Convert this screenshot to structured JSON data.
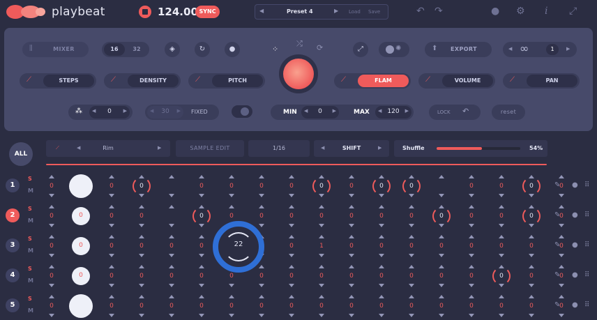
{
  "app": {
    "name": "playbeat",
    "bpm": "124.00",
    "sync_label": "SYNC"
  },
  "preset": {
    "name": "Preset 4",
    "load": "Load",
    "save": "Save"
  },
  "panel": {
    "mixer": "MIXER",
    "step16": "16",
    "step32": "32",
    "export": "EXPORT",
    "loop_count": "1",
    "steps": "STEPS",
    "density": "DENSITY",
    "pitch": "PITCH",
    "flam": "FLAM",
    "volume": "VOLUME",
    "pan": "PAN",
    "humanize_value": "0",
    "fixed_value": "30",
    "fixed_label": "FIXED",
    "min_label": "MIN",
    "min_value": "0",
    "max_label": "MAX",
    "max_value": "120",
    "lock": "LOCK",
    "reset": "reset"
  },
  "subbar": {
    "all": "ALL",
    "sound": "Rim",
    "sample_edit": "SAMPLE EDIT",
    "division": "1/16",
    "mode": "SHIFT",
    "shuffle_label": "Shuffle",
    "shuffle_value": "54%",
    "shuffle_level": 0.54
  },
  "colors": {
    "accent": "#ef5b5b",
    "focus": "#2f6fd6",
    "panel": "#474a6a",
    "bg": "#2b2d42"
  },
  "rows": [
    {
      "num": "1",
      "s": "S",
      "m": "M",
      "cells": [
        "0",
        "",
        "0",
        "0",
        "",
        "0",
        "0",
        "0",
        "0",
        "0",
        "0",
        "0",
        "0",
        "",
        "0",
        "0",
        "0",
        "0"
      ]
    },
    {
      "num": "2",
      "s": "S",
      "m": "M",
      "cells": [
        "0",
        "0",
        "0",
        "0",
        "",
        "0",
        "0",
        "0",
        "0",
        "0",
        "0",
        "0",
        "0",
        "0",
        "0",
        "0",
        "0",
        "0"
      ]
    },
    {
      "num": "3",
      "s": "S",
      "m": "M",
      "cells": [
        "0",
        "0",
        "0",
        "0",
        "0",
        "0",
        "22",
        "0",
        "0",
        "1",
        "0",
        "0",
        "0",
        "0",
        "0",
        "0",
        "0",
        "0"
      ]
    },
    {
      "num": "4",
      "s": "S",
      "m": "M",
      "cells": [
        "0",
        "0",
        "0",
        "0",
        "0",
        "0",
        "0",
        "0",
        "0",
        "0",
        "0",
        "0",
        "0",
        "0",
        "0",
        "0",
        "0",
        "0"
      ]
    },
    {
      "num": "5",
      "s": "S",
      "m": "M",
      "cells": [
        "0",
        "",
        "0",
        "0",
        "0",
        "0",
        "0",
        "0",
        "0",
        "0",
        "0",
        "0",
        "0",
        "0",
        "0",
        "0",
        "0",
        "0"
      ]
    }
  ]
}
